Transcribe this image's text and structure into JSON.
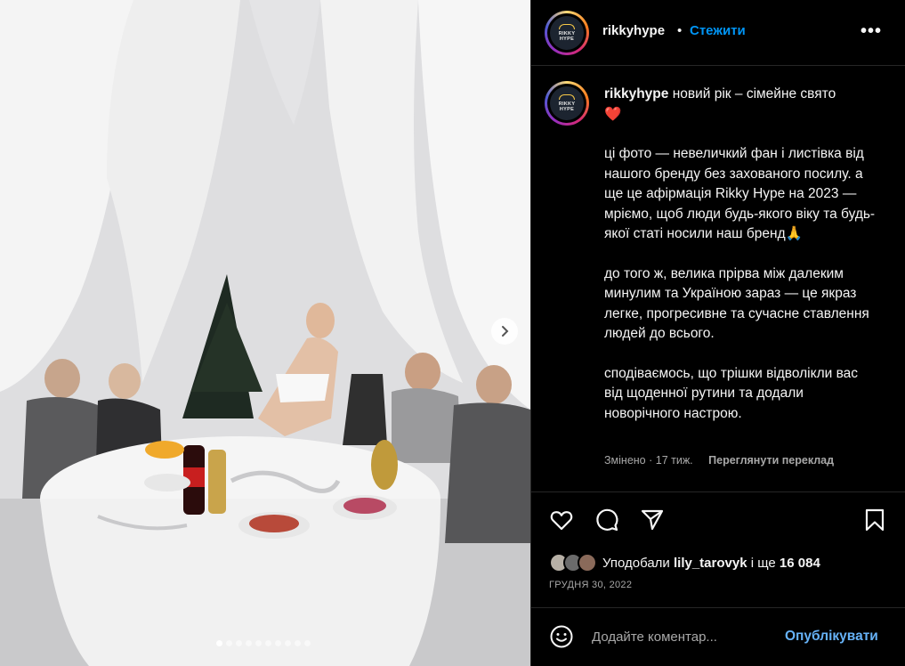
{
  "post": {
    "username": "rikkyhype",
    "separator": "•",
    "follow_label": "Стежити",
    "more_label": "•••",
    "logo_text_line1": "RIKKY",
    "logo_text_line2": "HYPE"
  },
  "caption": {
    "line1": "новий рік – сімейне свято",
    "heart_emoji": "❤️",
    "para1": "ці фото — невеличкий фан і листівка від нашого бренду без захованого посилу. а ще це афірмація Rikky Hype на 2023 — мріємо, щоб люди будь-якого віку та будь-якої статі носили наш бренд🙏",
    "para2": "до того ж, велика прірва між далеким минулим та Україною зараз — це якраз легке, прогресивне та сучасне ставлення людей до всього.",
    "para3": "сподіваємось, що трішки відволікли вас від щоденної рутини та додали новорічного настрою.",
    "edited": "Змінено · 17 тиж.",
    "translate_label": "Переглянути переклад"
  },
  "actions": {
    "like_icon": "heart-outline-icon",
    "comment_icon": "comment-bubble-icon",
    "share_icon": "paper-plane-icon",
    "save_icon": "bookmark-icon"
  },
  "likes": {
    "prefix": "Уподобали ",
    "user": "lily_tarovyk",
    "middle": " і ще ",
    "count": "16 084"
  },
  "date": "ГРУДНЯ 30, 2022",
  "comment": {
    "placeholder": "Додайте коментар...",
    "publish_label": "Опублікувати"
  },
  "carousel": {
    "total_slides": 10,
    "active_index": 0
  },
  "colors": {
    "accent_blue": "#0095f6",
    "publish_blue": "#66b2f7",
    "muted_text": "#a8a8a8",
    "divider": "#262626"
  }
}
